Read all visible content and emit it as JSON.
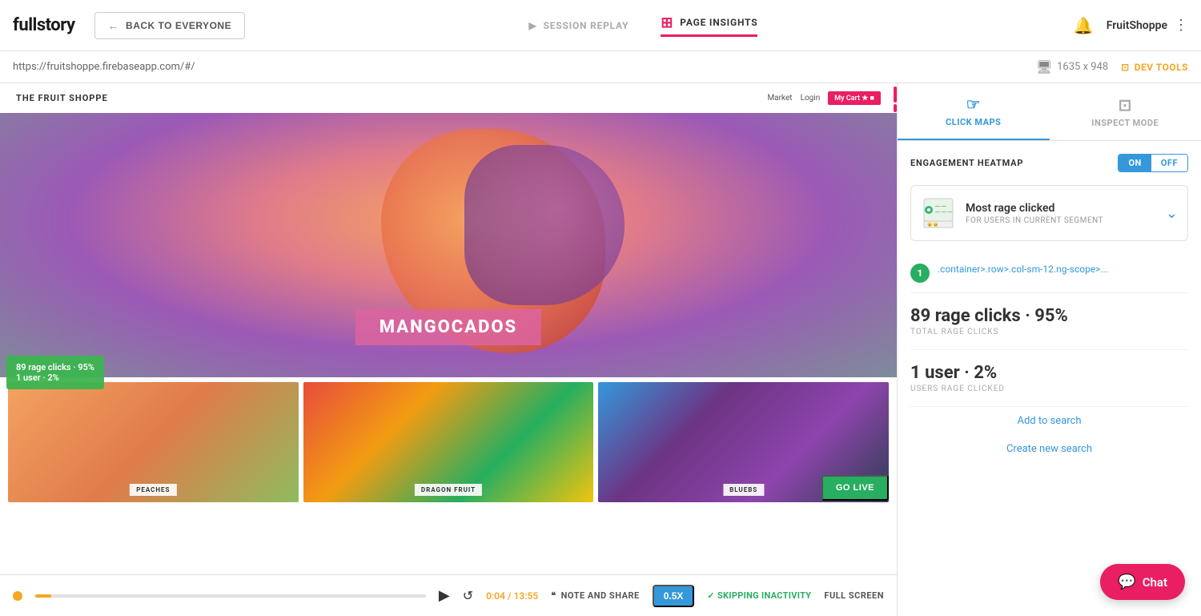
{
  "logo": {
    "text": "fullstory"
  },
  "nav": {
    "back_label": "BACK TO EVERYONE",
    "session_replay_label": "SESSION REPLAY",
    "page_insights_label": "PAGE INSIGHTS",
    "user_name": "FruitShoppe",
    "bell_icon": "🔔"
  },
  "url_bar": {
    "url": "https://fruitshoppe.firebaseapp.com/#/",
    "resolution": "1635 x 948",
    "dev_tools_label": "DEV TOOLS"
  },
  "panel": {
    "click_maps_label": "CLICK MAPS",
    "inspect_mode_label": "INSPECT MODE",
    "heatmap_title": "ENGAGEMENT HEATMAP",
    "toggle_on": "ON",
    "toggle_off": "OFF",
    "rage_title": "Most rage clicked",
    "rage_subtitle": "FOR USERS IN CURRENT SEGMENT",
    "selector_code": ".container>.row>.col-sm-12.ng-scope>...",
    "selector_badge": "1",
    "rage_clicks_stat": "89 rage clicks · 95%",
    "rage_clicks_label": "TOTAL RAGE CLICKS",
    "user_stat": "1 user · 2%",
    "user_label": "USERS RAGE CLICKED",
    "add_to_search": "Add to search",
    "create_new_search": "Create new search"
  },
  "fruit_shoppe": {
    "title": "THE FRUIT SHOPPE",
    "nav_market": "Market",
    "nav_login": "Login",
    "nav_cart": "My Cart ★ ■",
    "hero_text": "MANGOCADOS",
    "peaches_label": "PEACHES",
    "dragon_label": "DRAGON FRUIT",
    "bluebs_label": "BLUEBS",
    "go_live_label": "GO LIVE",
    "rage_tooltip_line1": "89 rage clicks · 95%",
    "rage_tooltip_line2": "1 user · 2%"
  },
  "player": {
    "time_current": "0:04",
    "time_total": "13:55",
    "note_label": "NOTE AND SHARE",
    "speed_label": "0.5X",
    "skip_label": "✓ SKIPPING INACTIVITY",
    "fullscreen_label": "FULL SCREEN"
  },
  "chat": {
    "label": "Chat"
  }
}
